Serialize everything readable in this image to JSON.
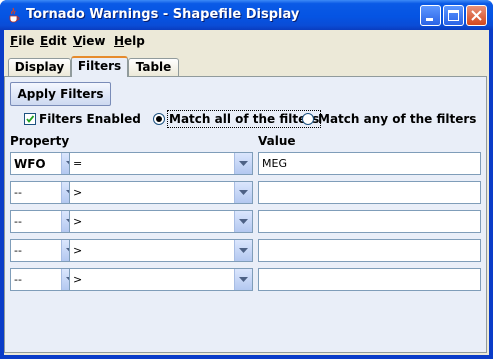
{
  "window": {
    "title": "Tornado Warnings - Shapefile Display",
    "icon": "java-cup-icon",
    "controls": [
      "minimize-icon",
      "maximize-icon",
      "close-icon"
    ]
  },
  "menubar": {
    "items": [
      {
        "label": "File",
        "mnemonic": "F",
        "rest": "ile"
      },
      {
        "label": "Edit",
        "mnemonic": "E",
        "rest": "dit"
      },
      {
        "label": "View",
        "mnemonic": "V",
        "rest": "iew"
      },
      {
        "label": "Help",
        "mnemonic": "H",
        "rest": "elp"
      }
    ]
  },
  "tabs": [
    {
      "label": "Display",
      "selected": false
    },
    {
      "label": "Filters",
      "selected": true
    },
    {
      "label": "Table",
      "selected": false
    }
  ],
  "filters": {
    "apply_label": "Apply Filters",
    "enabled_label": "Filters Enabled",
    "enabled_checked": true,
    "match_all_label": "Match all of the filters",
    "match_any_label": "Match any of the filters",
    "match_mode": "all",
    "property_header": "Property",
    "value_header": "Value",
    "rows": [
      {
        "property": "WFO",
        "operator": "=",
        "value": "MEG"
      },
      {
        "property": "--",
        "operator": ">",
        "value": ""
      },
      {
        "property": "--",
        "operator": ">",
        "value": ""
      },
      {
        "property": "--",
        "operator": ">",
        "value": ""
      },
      {
        "property": "--",
        "operator": ">",
        "value": ""
      }
    ]
  },
  "colors": {
    "titlebar": "#0554e3",
    "panel": "#e9eef8",
    "window_bg": "#ece9d8",
    "tab_highlight": "#e68b2c"
  }
}
